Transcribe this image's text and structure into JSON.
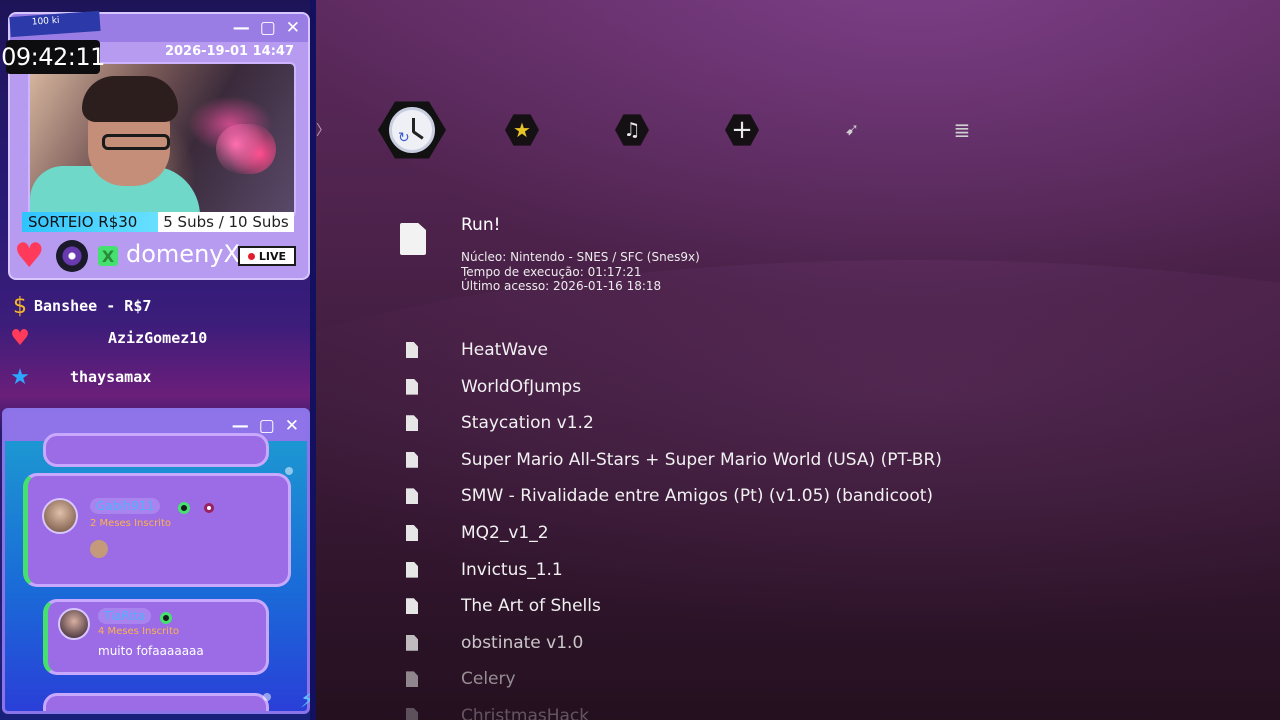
{
  "overlay": {
    "badge_top": "100 ki",
    "clock": "09:42:11",
    "cam_timestamp": "2026-19-01 14:47",
    "sorteio": "SORTEIO R$30",
    "subs": "5 Subs / 10 Subs",
    "streamer": "domenyX",
    "live": "LIVE",
    "alerts": [
      {
        "icon": "dollar-icon",
        "text": "Banshee - R$7",
        "color": "#f5b52a"
      },
      {
        "icon": "heart-icon",
        "text": "AzizGomez10",
        "color": "#ff3a5a"
      },
      {
        "icon": "star-icon",
        "text": "thaysamax",
        "color": "#2fa6ff"
      }
    ],
    "chat": [
      {
        "user": "Gabih911",
        "months": "2 Meses Inscrito",
        "message": ""
      },
      {
        "user": "TiaRita",
        "months": "4 Meses Inscrito",
        "message": "muito fofaaaaaaa"
      }
    ]
  },
  "xmb": {
    "tabs": [
      {
        "name": "history-tab",
        "icon": "clock-icon",
        "glyph": ""
      },
      {
        "name": "favorites-tab",
        "icon": "star-icon",
        "glyph": "★"
      },
      {
        "name": "music-tab",
        "icon": "music-icon",
        "glyph": "♫"
      },
      {
        "name": "add-tab",
        "icon": "plus-icon",
        "glyph": "+"
      },
      {
        "name": "netplay-tab",
        "icon": "rocket-icon",
        "glyph": "➹"
      },
      {
        "name": "database-tab",
        "icon": "database-icon",
        "glyph": "≣"
      }
    ],
    "focus": {
      "title": "Run!",
      "core": "Núcleo: Nintendo - SNES / SFC (Snes9x)",
      "runtime": "Tempo de execução: 01:17:21",
      "last": "Último acesso: 2026-01-16 18:18"
    },
    "games": [
      "HeatWave",
      "WorldOfJumps",
      "Staycation v1.2",
      "Super Mario All-Stars + Super Mario World (USA) (PT-BR)",
      "SMW - Rivalidade entre Amigos (Pt) (v1.05) (bandicoot)",
      "MQ2_v1_2",
      "Invictus_1.1",
      "The Art of Shells",
      "obstinate v1.0",
      "Celery",
      "ChristmasHack"
    ]
  }
}
